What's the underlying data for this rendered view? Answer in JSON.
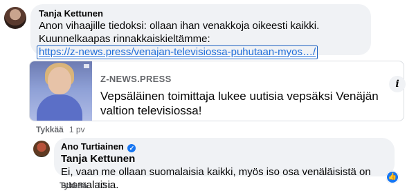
{
  "comment1": {
    "author": "Tanja Kettunen",
    "text": "Anon vihaajille tiedoksi: ollaan ihan venakkoja oikeesti kaikki. Kuunnelkaapas rinnakkaiskieltämme:",
    "link": "https://z-news.press/venajan-televisiossa-puhutaan-myos…/",
    "like_label": "Tykkää",
    "time": "1 pv"
  },
  "link_preview": {
    "source": "Z-NEWS.PRESS",
    "title": "Vepsäläinen toimittaja lukee uutisia vepsäksi Venäjän valtion televisiossa!",
    "info_icon": "i"
  },
  "reply": {
    "author": "Ano Turtiainen",
    "verified_glyph": "✓",
    "mention": "Tanja Kettunen",
    "text": "Ei, vaan me ollaan suomalaisia kaikki, myös iso osa venäläisistä on suomalaisia.",
    "like_label": "Tykkää",
    "time": "13 t",
    "reaction_glyph": "👍"
  },
  "colors": {
    "link": "#216fdb",
    "bubble_bg": "#f0f2f5",
    "meta": "#65676b",
    "facebook_blue": "#1877f2"
  }
}
